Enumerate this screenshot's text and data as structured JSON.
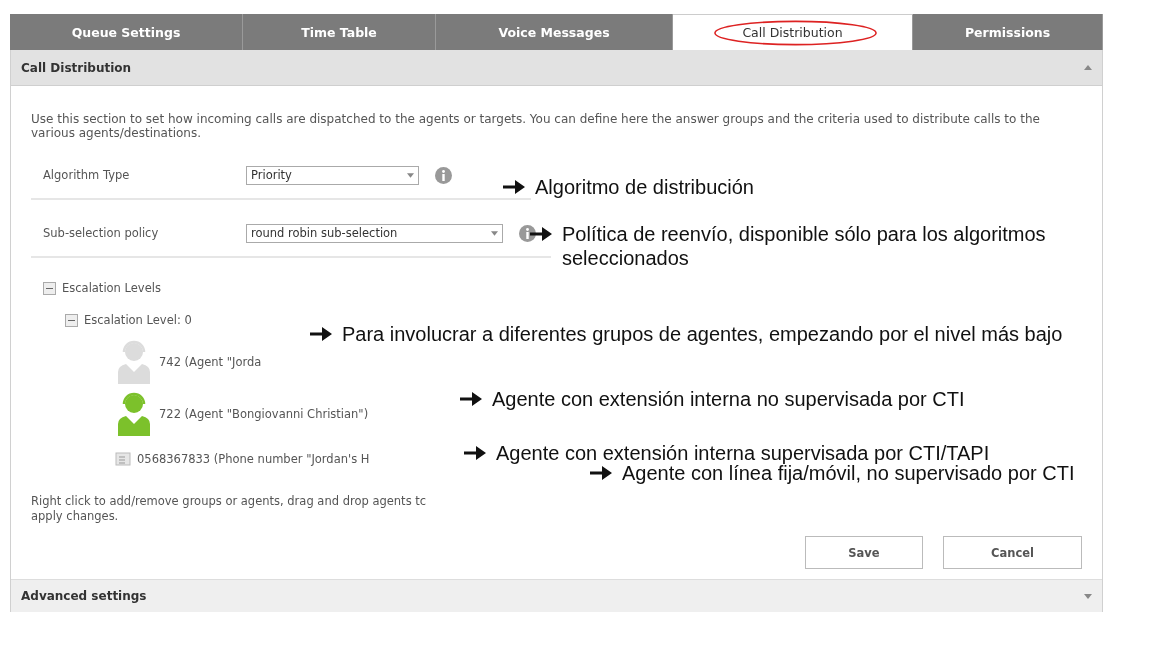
{
  "tabs": [
    {
      "label": "Queue Settings",
      "selected": false
    },
    {
      "label": "Time Table",
      "selected": false
    },
    {
      "label": "Voice Messages",
      "selected": false
    },
    {
      "label": "Call Distribution",
      "selected": true
    },
    {
      "label": "Permissions",
      "selected": false
    }
  ],
  "section": {
    "title": "Call Distribution",
    "expanded": true
  },
  "description": "Use this section to set how incoming calls are dispatched to the agents or targets. You can define here the answer groups and the criteria used to distribute calls to the various agents/destinations.",
  "fields": [
    {
      "label": "Algorithm Type",
      "value": "Priority"
    },
    {
      "label": "Sub-selection policy",
      "value": "round robin sub-selection"
    }
  ],
  "tree": [
    {
      "label": "Escalation Levels",
      "kind": "group",
      "expanded": true,
      "children": [
        {
          "label": "Escalation Level: 0",
          "kind": "group",
          "expanded": true,
          "children": [
            {
              "label": "742 (Agent \"Jorda",
              "kind": "agent-offline"
            },
            {
              "label": "722 (Agent \"Bongiovanni Christian\")",
              "kind": "agent-online"
            },
            {
              "label": "0568367833 (Phone number \"Jordan's H",
              "kind": "phone"
            }
          ]
        }
      ]
    }
  ],
  "help_lines": [
    "Right click to add/remove groups or agents, drag and drop agents tc",
    "apply changes."
  ],
  "buttons": [
    "Save",
    "Cancel"
  ],
  "advanced": {
    "title": "Advanced settings",
    "expanded": false
  },
  "annotations": [
    "Algoritmo de distribución",
    "Política de reenvío, disponible sólo para los algoritmos seleccionados",
    "Para involucrar a diferentes grupos de agentes, empezando por el nivel más bajo",
    "Agente con extensión interna no supervisada por CTI",
    "Agente con extensión interna supervisada por CTI/TAPI",
    "Agente con línea fija/móvil, no supervisado por CTI"
  ]
}
